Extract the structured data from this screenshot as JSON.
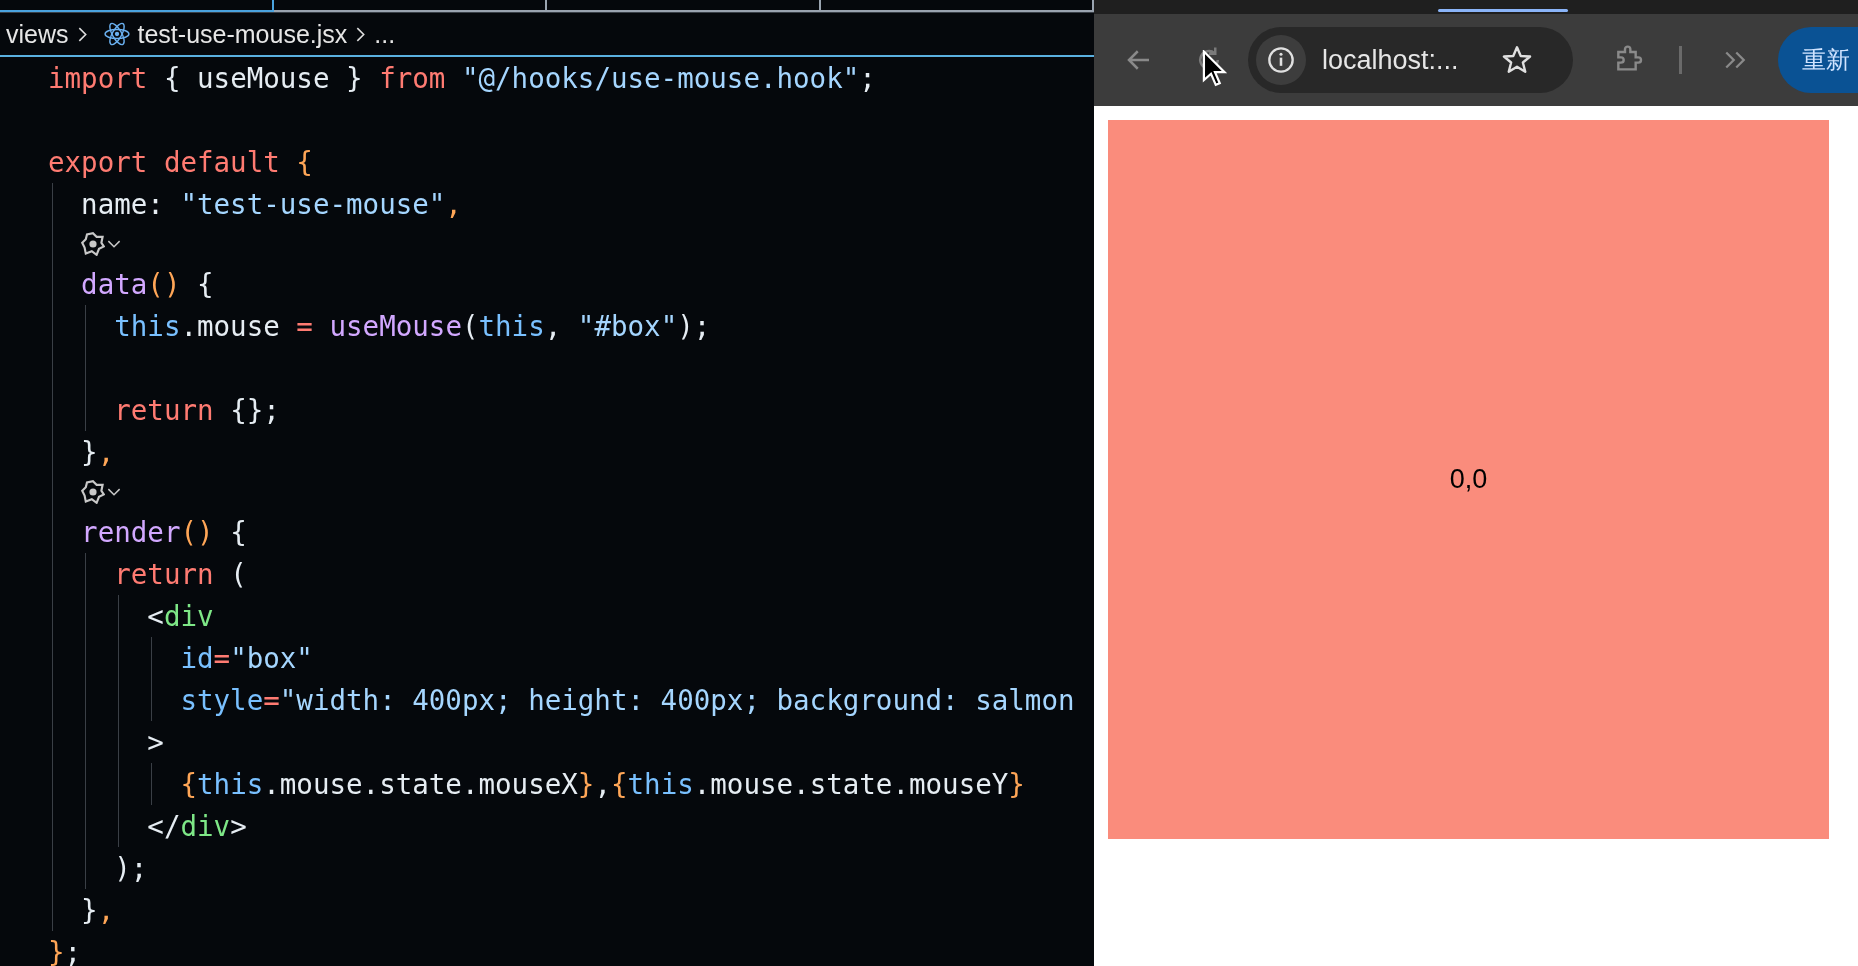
{
  "editor": {
    "breadcrumb": [
      {
        "kind": "folder",
        "label": "views"
      },
      {
        "kind": "file",
        "label": "test-use-mouse.jsx"
      },
      {
        "kind": "more",
        "label": "..."
      }
    ],
    "lines": [
      {
        "kind": "code",
        "tokens": [
          {
            "kind": "kw",
            "text": "import"
          },
          {
            "kind": "p",
            "text": " { useMouse } "
          },
          {
            "kind": "kw",
            "text": "from"
          },
          {
            "kind": "str",
            "text": " \"@/hooks/use-mouse.hook\""
          },
          {
            "kind": "p",
            "text": ";"
          }
        ]
      },
      {
        "kind": "blank"
      },
      {
        "kind": "code",
        "tokens": [
          {
            "kind": "kw",
            "text": "export default "
          },
          {
            "kind": "br",
            "text": "{"
          }
        ]
      },
      {
        "kind": "code",
        "tokens": [
          {
            "kind": "p",
            "text": "  name: "
          },
          {
            "kind": "str",
            "text": "\"test-use-mouse\""
          },
          {
            "kind": "br",
            "text": ","
          }
        ]
      },
      {
        "kind": "codelens"
      },
      {
        "kind": "code",
        "tokens": [
          {
            "kind": "fn",
            "text": "  data"
          },
          {
            "kind": "br",
            "text": "()"
          },
          {
            "kind": "p",
            "text": " {"
          }
        ]
      },
      {
        "kind": "code",
        "tokens": [
          {
            "kind": "this",
            "text": "    this"
          },
          {
            "kind": "p",
            "text": ".mouse "
          },
          {
            "kind": "kw",
            "text": "= "
          },
          {
            "kind": "fn",
            "text": "useMouse"
          },
          {
            "kind": "p",
            "text": "("
          },
          {
            "kind": "this",
            "text": "this"
          },
          {
            "kind": "p",
            "text": ", "
          },
          {
            "kind": "str",
            "text": "\"#box\""
          },
          {
            "kind": "p",
            "text": ");"
          }
        ]
      },
      {
        "kind": "blank"
      },
      {
        "kind": "code",
        "tokens": [
          {
            "kind": "kw",
            "text": "    return"
          },
          {
            "kind": "p",
            "text": " {};"
          }
        ]
      },
      {
        "kind": "code",
        "tokens": [
          {
            "kind": "p",
            "text": "  }"
          },
          {
            "kind": "br",
            "text": ","
          }
        ]
      },
      {
        "kind": "codelens"
      },
      {
        "kind": "code",
        "tokens": [
          {
            "kind": "fn",
            "text": "  render"
          },
          {
            "kind": "br",
            "text": "()"
          },
          {
            "kind": "p",
            "text": " {"
          }
        ]
      },
      {
        "kind": "code",
        "tokens": [
          {
            "kind": "kw",
            "text": "    return"
          },
          {
            "kind": "p",
            "text": " ("
          }
        ]
      },
      {
        "kind": "code",
        "tokens": [
          {
            "kind": "p",
            "text": "      <"
          },
          {
            "kind": "tag",
            "text": "div"
          }
        ]
      },
      {
        "kind": "code",
        "tokens": [
          {
            "kind": "attr",
            "text": "        id"
          },
          {
            "kind": "kw",
            "text": "="
          },
          {
            "kind": "str",
            "text": "\"box\""
          }
        ]
      },
      {
        "kind": "code",
        "tokens": [
          {
            "kind": "attr",
            "text": "        style"
          },
          {
            "kind": "kw",
            "text": "="
          },
          {
            "kind": "str",
            "text": "\"width: 400px; height: 400px; background: salmon"
          }
        ]
      },
      {
        "kind": "code",
        "tokens": [
          {
            "kind": "p",
            "text": "      >"
          }
        ]
      },
      {
        "kind": "code",
        "tokens": [
          {
            "kind": "br",
            "text": "        {"
          },
          {
            "kind": "this",
            "text": "this"
          },
          {
            "kind": "p",
            "text": ".mouse.state.mouseX"
          },
          {
            "kind": "br",
            "text": "}"
          },
          {
            "kind": "p",
            "text": ","
          },
          {
            "kind": "br",
            "text": "{"
          },
          {
            "kind": "this",
            "text": "this"
          },
          {
            "kind": "p",
            "text": ".mouse.state.mouseY"
          },
          {
            "kind": "br",
            "text": "}"
          }
        ]
      },
      {
        "kind": "code",
        "tokens": [
          {
            "kind": "p",
            "text": "      </"
          },
          {
            "kind": "tag",
            "text": "div"
          },
          {
            "kind": "p",
            "text": ">"
          }
        ]
      },
      {
        "kind": "code",
        "tokens": [
          {
            "kind": "p",
            "text": "    );"
          }
        ]
      },
      {
        "kind": "code",
        "tokens": [
          {
            "kind": "p",
            "text": "  }"
          },
          {
            "kind": "br",
            "text": ","
          }
        ]
      },
      {
        "kind": "code",
        "tokens": [
          {
            "kind": "br",
            "text": "}"
          },
          {
            "kind": "p",
            "text": ";"
          }
        ]
      }
    ]
  },
  "browser": {
    "address": "localhost:...",
    "action_button": "重新",
    "box_text": "0,0"
  }
}
